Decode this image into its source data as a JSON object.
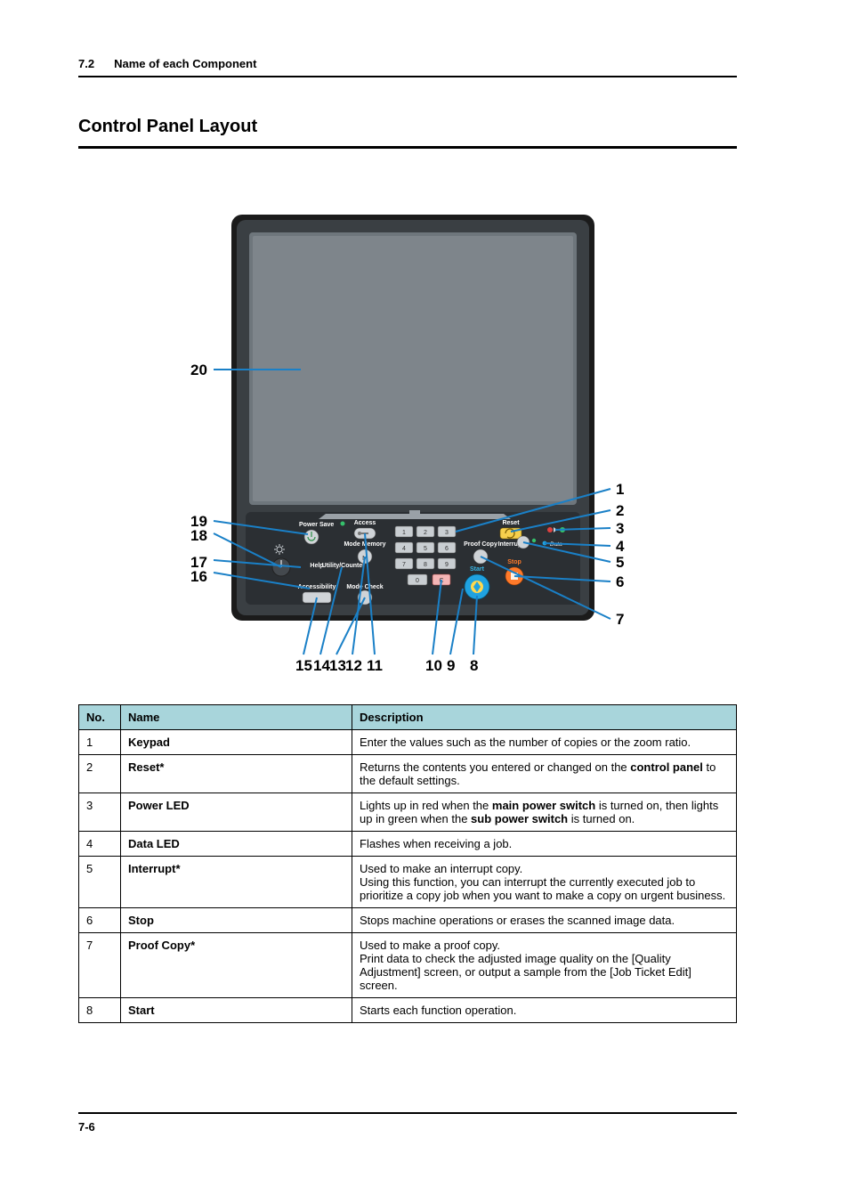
{
  "header": {
    "section_no": "7.2",
    "section_title": "Name of each Component"
  },
  "title": "Control Panel Layout",
  "footer": {
    "page_no": "7-6"
  },
  "callouts": {
    "left_upper": [
      "20"
    ],
    "left_lower": [
      "19",
      "18",
      "17",
      "16"
    ],
    "bottom": [
      "15",
      "14",
      "13",
      "12",
      "11",
      "10",
      "9",
      "8"
    ],
    "right": [
      "1",
      "2",
      "3",
      "4",
      "5",
      "6",
      "7"
    ]
  },
  "panel_labels": {
    "power_save": "Power Save",
    "access": "Access",
    "mode_memory": "Mode Memory",
    "help": "Help",
    "utility_counter": "Utility/Counter",
    "accessibility": "Accessibility",
    "mode_check": "Mode Check",
    "proof_copy": "Proof Copy",
    "reset": "Reset",
    "interrupt": "Interrupt",
    "data": "Data",
    "stop": "Stop",
    "start": "Start",
    "clear_key": "C"
  },
  "table": {
    "headers": {
      "no": "No.",
      "name": "Name",
      "desc": "Description"
    },
    "rows": [
      {
        "no": "1",
        "name": "Keypad",
        "desc": "Enter the values such as the number of copies or the zoom ratio."
      },
      {
        "no": "2",
        "name": "Reset",
        "asterisk": true,
        "desc_html": "Returns the contents you entered or changed on the <b>control panel</b> to the default settings."
      },
      {
        "no": "3",
        "name": "Power LED",
        "desc_html": "Lights up in red when the <b>main power switch</b> is turned on, then lights up in green when the <b>sub power switch</b> is turned on."
      },
      {
        "no": "4",
        "name": "Data LED",
        "desc": "Flashes when receiving a job."
      },
      {
        "no": "5",
        "name": "Interrupt",
        "asterisk": true,
        "desc": "Used to make an interrupt copy.\nUsing this function, you can interrupt the currently executed job to prioritize a copy job when you want to make a copy on urgent business."
      },
      {
        "no": "6",
        "name": "Stop",
        "desc": "Stops machine operations or erases the scanned image data."
      },
      {
        "no": "7",
        "name": "Proof Copy",
        "asterisk": true,
        "desc": "Used to make a proof copy.\nPrint data to check the adjusted image quality on the [Quality Adjustment] screen, or output a sample from the [Job Ticket Edit] screen."
      },
      {
        "no": "8",
        "name": "Start",
        "desc": "Starts each function operation."
      }
    ]
  }
}
